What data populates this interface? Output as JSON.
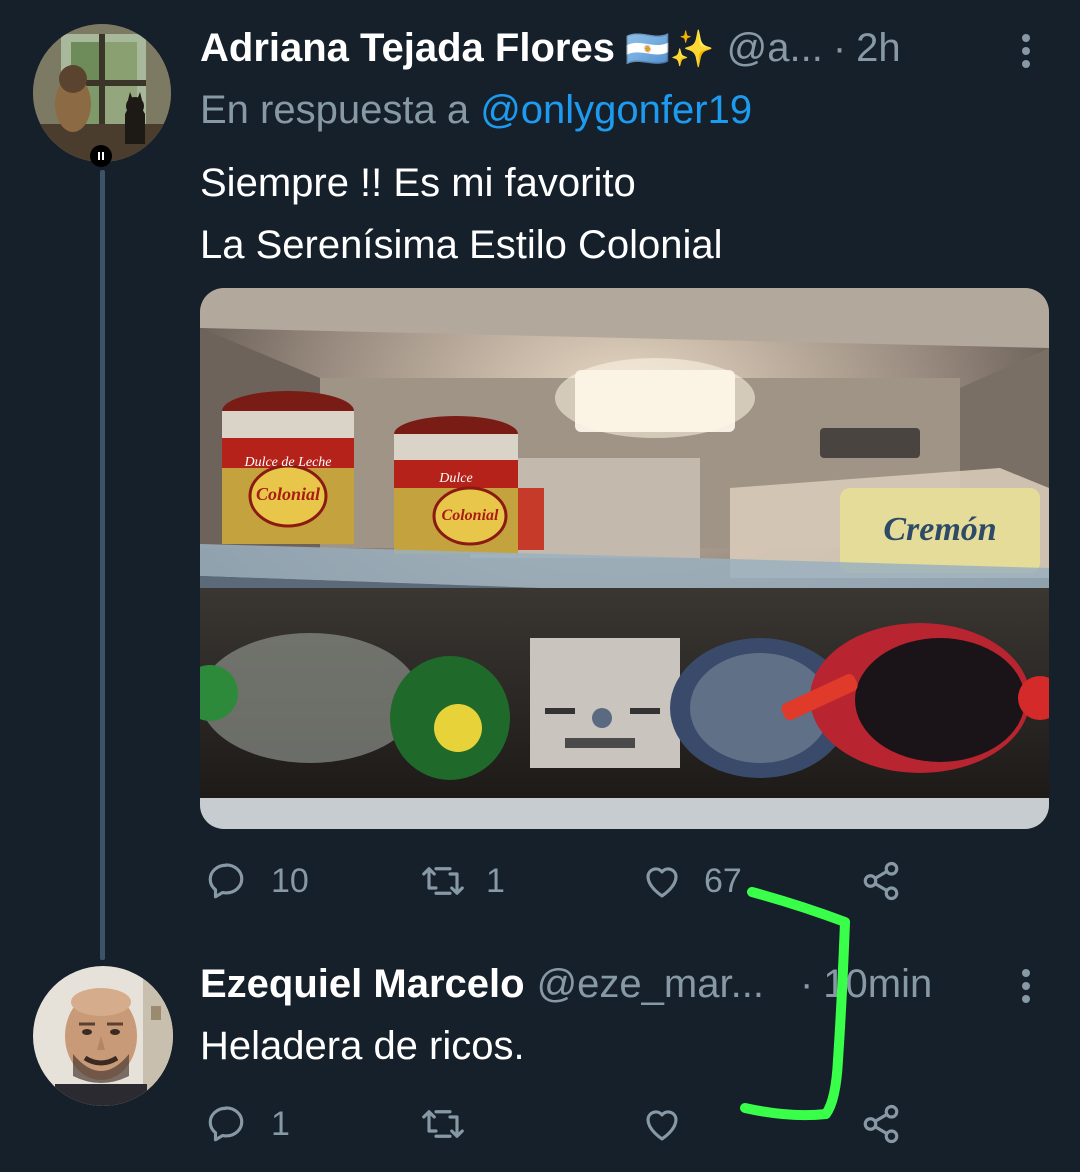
{
  "tweets": [
    {
      "display_name": "Adriana Tejada Flores",
      "emoji": "🇦🇷✨",
      "handle": "@a...",
      "separator": "·",
      "time": "2h",
      "reply_prefix": "En respuesta a ",
      "reply_mention": "@onlygonfer19",
      "text": "Siempre !! Es mi favorito\nLa Serenísima Estilo Colonial",
      "media_labels": {
        "jar1": "Dulce de Leche",
        "jar1_sub": "Colonial",
        "jar2": "Dulce",
        "jar2_sub": "Colonial",
        "tub": "Cremón"
      },
      "actions": {
        "reply_count": "10",
        "retweet_count": "1",
        "like_count": "67"
      }
    },
    {
      "display_name": "Ezequiel Marcelo",
      "handle": "@eze_mar...",
      "separator": "·",
      "time": "10min",
      "text": "Heladera de ricos.",
      "actions": {
        "reply_count": "1",
        "retweet_count": "",
        "like_count": ""
      }
    }
  ],
  "icons": {
    "reply": "reply-icon",
    "retweet": "retweet-icon",
    "like": "heart-icon",
    "share": "share-icon",
    "more": "more-vertical-icon"
  },
  "colors": {
    "background": "#15202b",
    "secondary_text": "#8899a6",
    "link": "#1d9bf0",
    "thread_line": "#3d5466",
    "annotation": "#39ff4a"
  }
}
